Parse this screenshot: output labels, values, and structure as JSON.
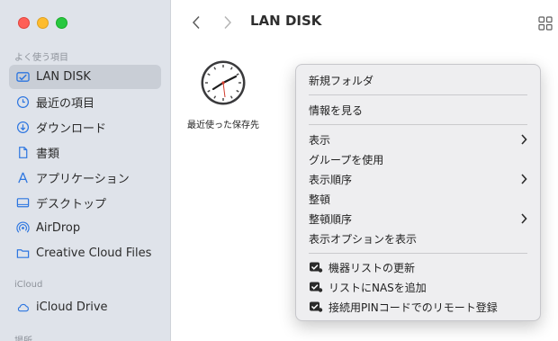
{
  "window": {
    "title": "LAN DISK"
  },
  "sidebar": {
    "favorites_title": "よく使う項目",
    "items": [
      {
        "label": "LAN DISK",
        "icon": "nas-drive-icon",
        "selected": true
      },
      {
        "label": "最近の項目",
        "icon": "clock-icon"
      },
      {
        "label": "ダウンロード",
        "icon": "download-icon"
      },
      {
        "label": "書類",
        "icon": "document-icon"
      },
      {
        "label": "アプリケーション",
        "icon": "applications-icon"
      },
      {
        "label": "デスクトップ",
        "icon": "desktop-icon"
      },
      {
        "label": "AirDrop",
        "icon": "airdrop-icon"
      },
      {
        "label": "Creative Cloud Files",
        "icon": "folder-icon"
      }
    ],
    "icloud_title": "iCloud",
    "icloud_items": [
      {
        "label": "iCloud Drive",
        "icon": "cloud-icon"
      }
    ],
    "locations_title": "場所"
  },
  "content": {
    "files": [
      {
        "label": "最近使った保存先",
        "icon": "clock-icon"
      }
    ]
  },
  "context_menu": {
    "items": [
      {
        "label": "新規フォルダ"
      },
      {
        "label": "情報を見る"
      },
      {
        "label": "表示",
        "submenu": true
      },
      {
        "label": "グループを使用"
      },
      {
        "label": "表示順序",
        "submenu": true
      },
      {
        "label": "整頓"
      },
      {
        "label": "整頓順序",
        "submenu": true
      },
      {
        "label": "表示オプションを表示"
      },
      {
        "label": "機器リストの更新",
        "icon": "nas-drive-icon"
      },
      {
        "label": "リストにNASを追加",
        "icon": "nas-drive-icon"
      },
      {
        "label": "接続用PINコードでのリモート登録",
        "icon": "nas-drive-icon"
      }
    ]
  },
  "colors": {
    "accent": "#2d76e0",
    "sidebar_bg": "#dfe3ea",
    "selection": "#c9ced6"
  }
}
